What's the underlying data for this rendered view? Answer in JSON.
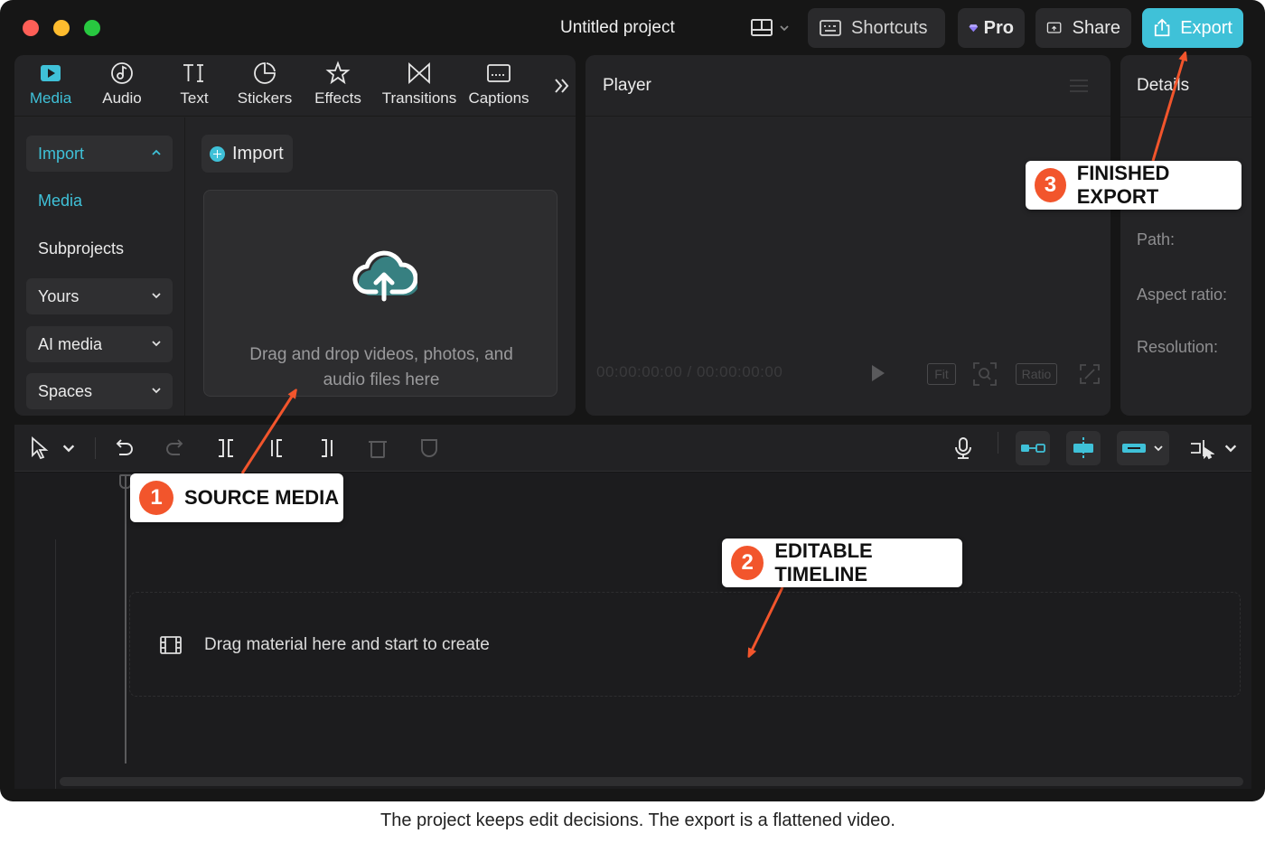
{
  "window": {
    "title": "Untitled project",
    "buttons": {
      "shortcuts": "Shortcuts",
      "pro": "Pro",
      "share": "Share",
      "export": "Export"
    }
  },
  "tool_tabs": [
    {
      "label": "Media",
      "icon": "media-icon",
      "active": true
    },
    {
      "label": "Audio",
      "icon": "audio-icon"
    },
    {
      "label": "Text",
      "icon": "text-icon"
    },
    {
      "label": "Stickers",
      "icon": "stickers-icon"
    },
    {
      "label": "Effects",
      "icon": "effects-icon"
    },
    {
      "label": "Transitions",
      "icon": "transitions-icon"
    },
    {
      "label": "Captions",
      "icon": "captions-icon"
    }
  ],
  "sidebar": {
    "items": [
      {
        "label": "Import"
      },
      {
        "label": "Media"
      },
      {
        "label": "Subprojects"
      },
      {
        "label": "Yours"
      },
      {
        "label": "AI media"
      },
      {
        "label": "Spaces"
      }
    ]
  },
  "media_panel": {
    "import_button": "Import",
    "dropzone_text": "Drag and drop videos, photos, and audio files here"
  },
  "player": {
    "title": "Player",
    "timecode": "00:00:00:00 / 00:00:00:00",
    "fit_label": "Fit",
    "ratio_label": "Ratio"
  },
  "details": {
    "title": "Details",
    "labels": [
      "Path:",
      "Aspect ratio:",
      "Resolution:"
    ]
  },
  "timeline": {
    "empty_text": "Drag material here and start to create"
  },
  "callouts": [
    {
      "number": "1",
      "label": "SOURCE MEDIA"
    },
    {
      "number": "2",
      "label": "EDITABLE TIMELINE"
    },
    {
      "number": "3",
      "label": "FINISHED EXPORT"
    }
  ],
  "caption": "The project keeps edit decisions. The export is a flattened video.",
  "colors": {
    "accent": "#3fc1d8",
    "callout_badge": "#f2552c",
    "background": "#161616"
  }
}
